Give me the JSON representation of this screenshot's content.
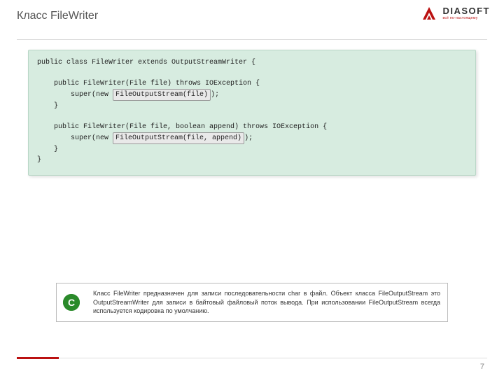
{
  "header": {
    "title": "Класс FileWriter"
  },
  "brand": {
    "name": "DIASOFT",
    "tagline": "всё по-настоящему"
  },
  "code": {
    "line1": "public class FileWriter extends OutputStreamWriter {",
    "line2": "",
    "line3": "    public FileWriter(File file) throws IOException {",
    "line4_pre": "        super(new ",
    "line4_hl": "FileOutputStream(file)",
    "line4_post": ");",
    "line5": "    }",
    "line6": "",
    "line7": "    public FileWriter(File file, boolean append) throws IOException {",
    "line8_pre": "        super(new ",
    "line8_hl": "FileOutputStream(file, append)",
    "line8_post": ");",
    "line9": "    }",
    "line10": "}"
  },
  "info": {
    "badge": "C",
    "text": "Класс FileWriter предназначен для записи последовательности char в файл. Объект класса FileOutputStream это OutputStreamWriter для записи в байтовый файловый поток вывода. При использовании FileOutputStream всегда используется кодировка по умолчанию."
  },
  "footer": {
    "page": "7"
  }
}
